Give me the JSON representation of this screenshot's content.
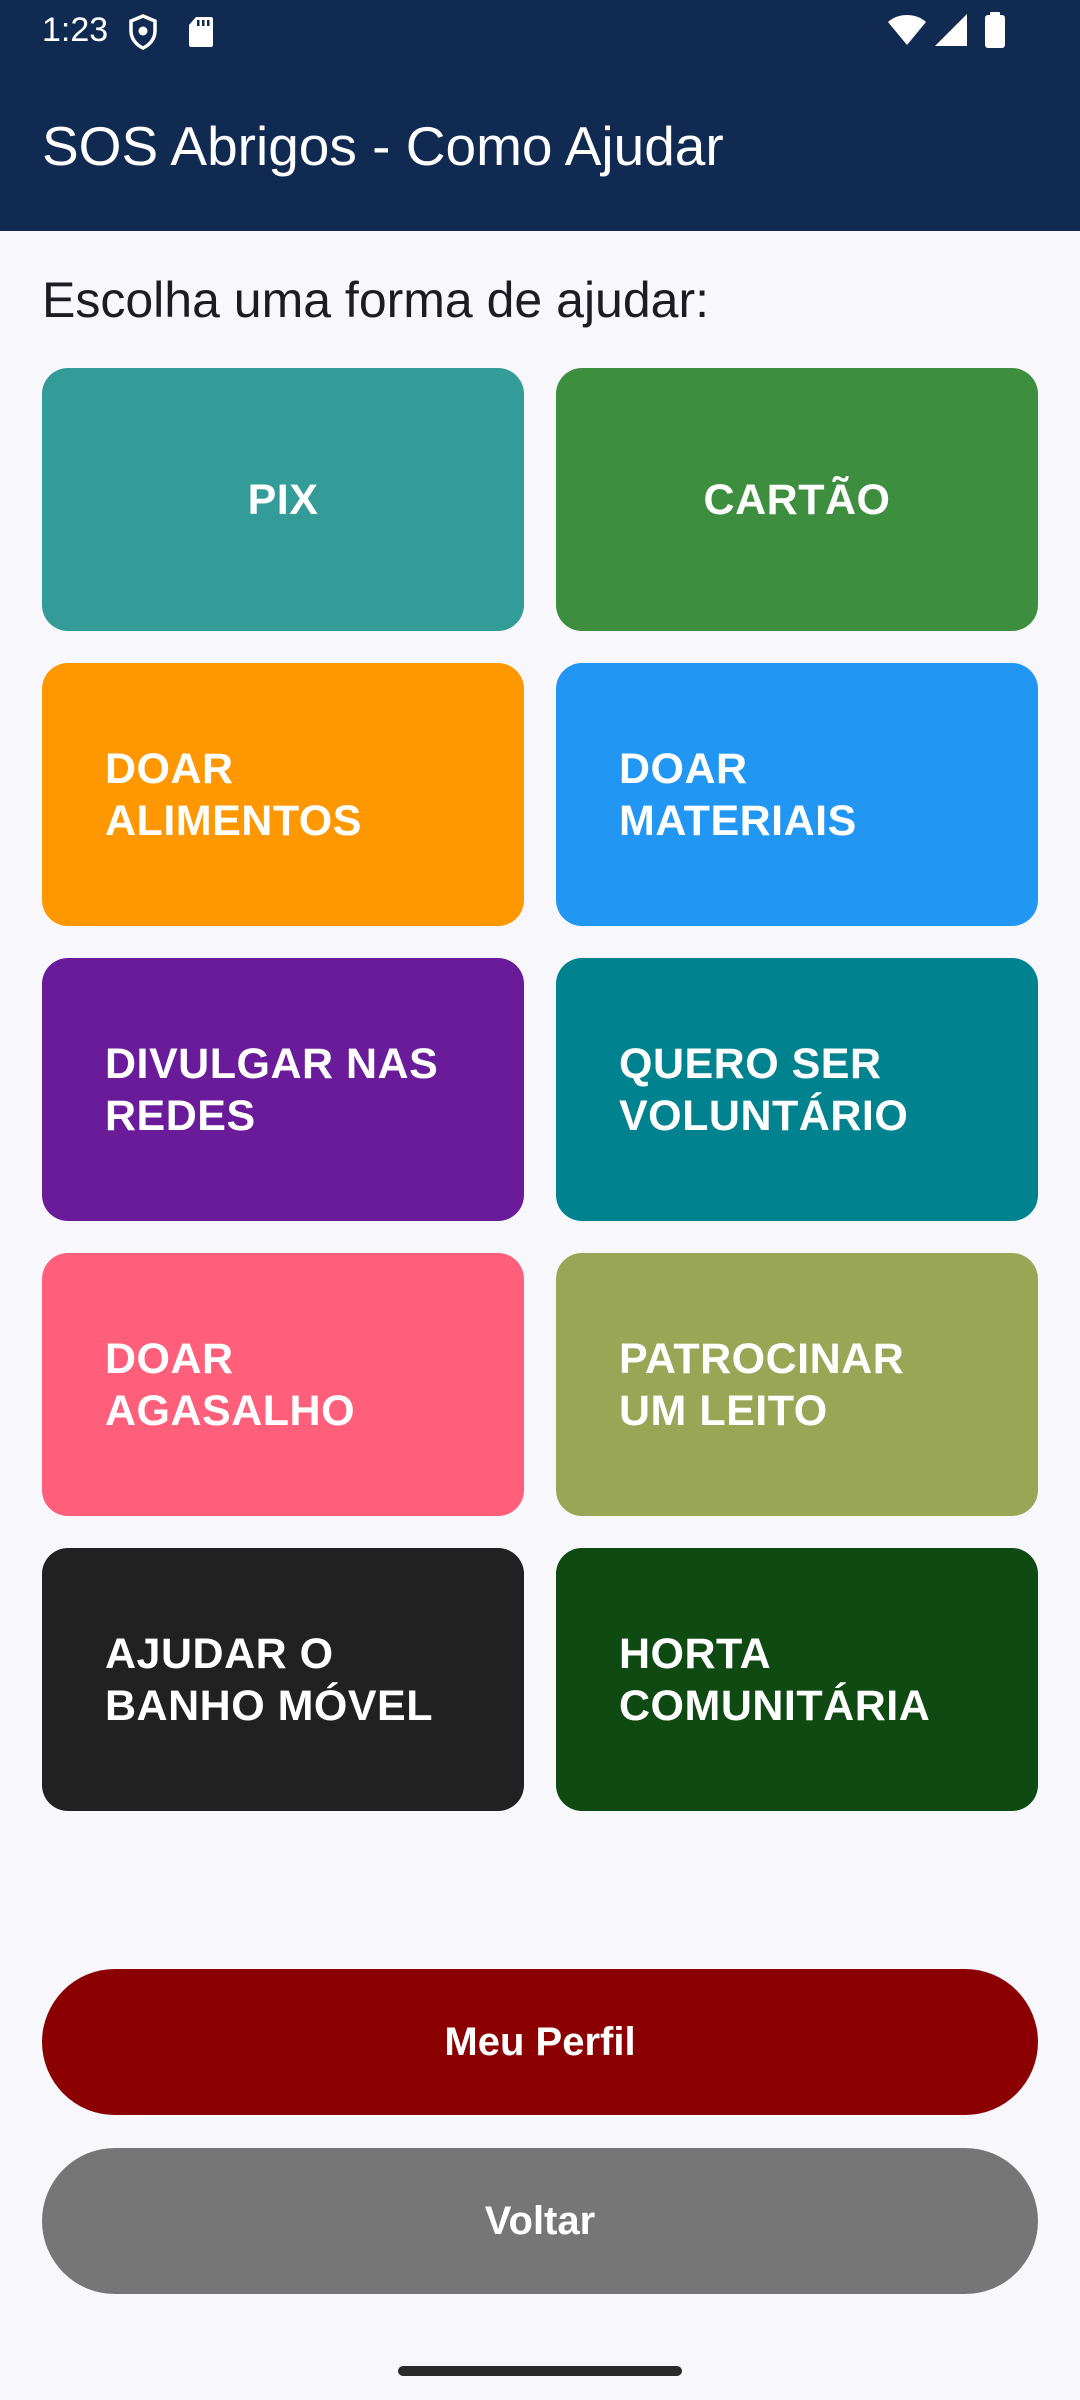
{
  "status_bar": {
    "time": "1:23",
    "icons": [
      "shield-icon",
      "sd-card-icon",
      "wifi-icon",
      "signal-icon",
      "battery-icon"
    ]
  },
  "app_bar": {
    "title": "SOS Abrigos - Como Ajudar",
    "background_color": "#102a52"
  },
  "prompt": "Escolha uma forma de ajudar:",
  "options": [
    {
      "label": "PIX",
      "color": "#339b98"
    },
    {
      "label": "CARTÃO",
      "color": "#3d8f3f"
    },
    {
      "label": "DOAR\nALIMENTOS",
      "color": "#ff9800"
    },
    {
      "label": "DOAR\nMATERIAIS",
      "color": "#2196f3"
    },
    {
      "label": "DIVULGAR NAS\nREDES",
      "color": "#6a1b9a"
    },
    {
      "label": "QUERO SER\nVOLUNTÁRIO",
      "color": "#00838f"
    },
    {
      "label": "DOAR\nAGASALHO",
      "color": "#ff5f7a"
    },
    {
      "label": "PATROCINAR\nUM LEITO",
      "color": "#99a656"
    },
    {
      "label": "AJUDAR O\nBANHO MÓVEL",
      "color": "#212121"
    },
    {
      "label": "HORTA\nCOMUNITÁRIA",
      "color": "#104a13"
    }
  ],
  "buttons": {
    "profile_label": "Meu Perfil",
    "profile_color": "#8b0000",
    "back_label": "Voltar",
    "back_color": "#767676"
  }
}
